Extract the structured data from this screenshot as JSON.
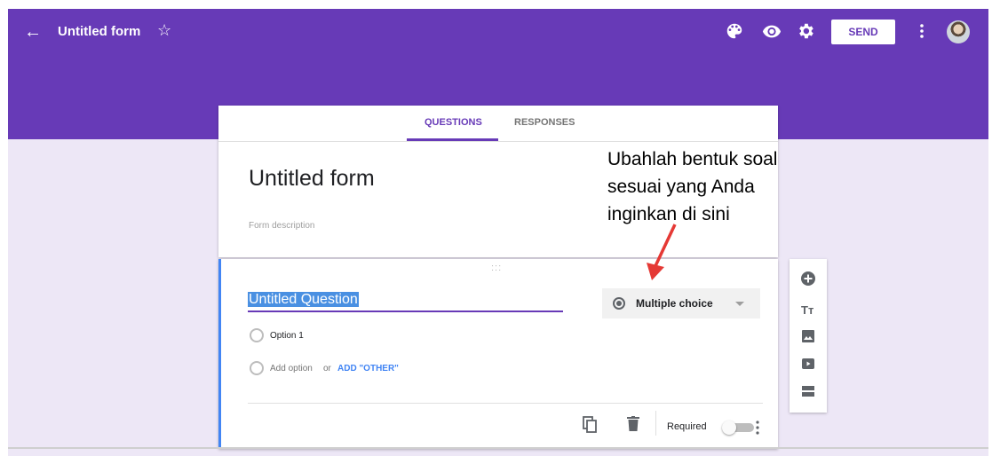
{
  "header": {
    "title": "Untitled form",
    "send_label": "SEND",
    "back_icon": "←",
    "star_icon": "☆"
  },
  "tabs": {
    "questions": "QUESTIONS",
    "responses": "RESPONSES",
    "active": "QUESTIONS"
  },
  "form": {
    "title": "Untitled form",
    "description_placeholder": "Form description"
  },
  "question": {
    "title": "Untitled Question",
    "drag_handle": ":::",
    "type": "Multiple choice",
    "options": [
      "Option 1"
    ],
    "add_option": "Add option",
    "or": "or",
    "add_other": "ADD \"OTHER\"",
    "required_label": "Required",
    "required": false
  },
  "toolbar": {
    "text_icon_glyph": "Tт"
  },
  "annotation": {
    "lines": [
      "Ubahlah bentuk soal",
      "sesuai yang Anda",
      "inginkan di sini"
    ]
  },
  "colors": {
    "primary": "#673ab7",
    "background": "#ede7f6",
    "accent_blue": "#4285f4",
    "arrow": "#e53935"
  },
  "icons": [
    "palette-icon",
    "eye-icon",
    "gear-icon",
    "more-vert-icon",
    "add-circle-icon",
    "title-icon",
    "image-icon",
    "video-icon",
    "section-icon",
    "copy-icon",
    "trash-icon"
  ]
}
